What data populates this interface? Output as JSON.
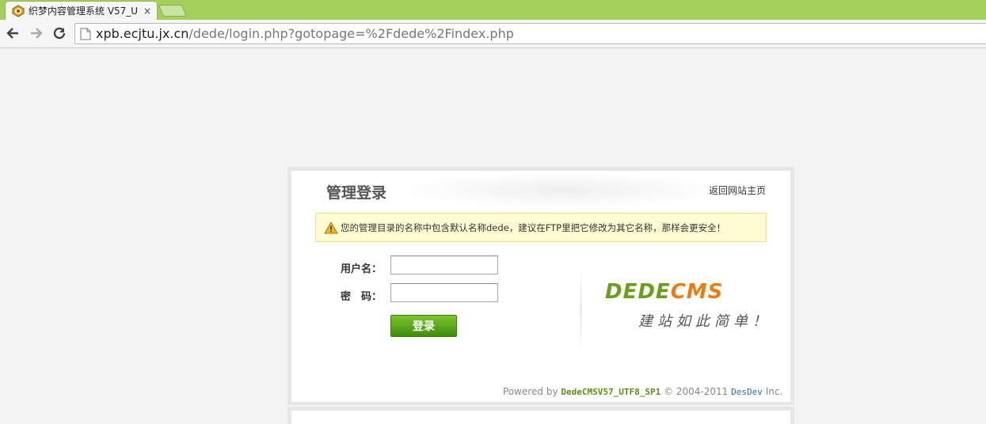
{
  "browser": {
    "tab_title": "织梦内容管理系统 V57_U",
    "tab_close": "×",
    "url_host": "xpb.ecjtu.jx.cn",
    "url_path": "/dede/login.php?gotopage=%2Fdede%2Findex.php",
    "accent_color": "#a3cf5b"
  },
  "login": {
    "title": "管理登录",
    "back_link": "返回网站主页",
    "warning": "您的管理目录的名称中包含默认名称dede，建议在FTP里把它修改为其它名称，那样会更安全！",
    "username_label": "用户名：",
    "password_label": "密　码：",
    "username_value": "",
    "password_value": "",
    "submit_label": "登录",
    "button_color": "#5aa51c"
  },
  "brand": {
    "logo_dede": "DEDE",
    "logo_cms": "CMS",
    "slogan": "建站如此简单！"
  },
  "footer": {
    "powered_by": "Powered by",
    "version": "DedeCMSV57_UTF8_SP1",
    "copyright": "© 2004-2011",
    "company": "DesDev",
    "inc": "Inc."
  }
}
